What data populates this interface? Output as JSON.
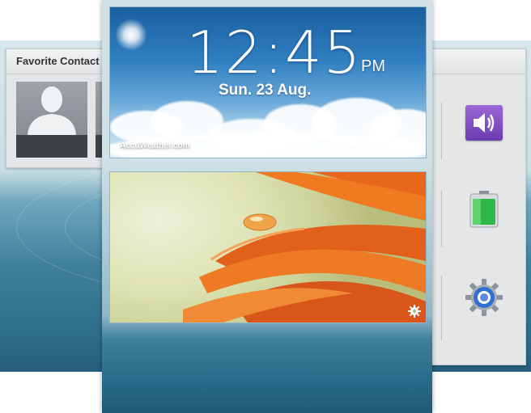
{
  "contacts_widget": {
    "title": "Favorite Contact",
    "contacts": [
      {
        "icon": "person-silhouette-icon"
      },
      {
        "icon": "person-silhouette-icon"
      }
    ]
  },
  "clock_widget": {
    "time": "12:45",
    "ampm": "PM",
    "date": "Sun. 23 Aug.",
    "brand": "AccuWeather.com"
  },
  "photo_widget": {
    "settings_icon": "gear-icon"
  },
  "quick_settings": [
    {
      "icon": "volume-icon",
      "color": "#7b4bc0"
    },
    {
      "icon": "battery-icon",
      "color": "#3cb84a"
    },
    {
      "icon": "settings-icon",
      "color": "#3a6fc4"
    }
  ]
}
